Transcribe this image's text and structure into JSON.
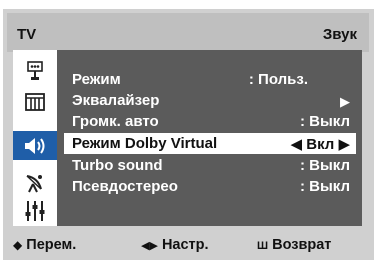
{
  "header": {
    "source": "TV",
    "title": "Звук"
  },
  "sidebar": {
    "icons": [
      "input-icon",
      "picture-icon",
      "sound-icon",
      "channel-icon",
      "setup-icon"
    ],
    "active_index": 2
  },
  "menu": {
    "items": [
      {
        "label": "Режим",
        "value": ": Польз."
      },
      {
        "label": "Эквалайзер",
        "value": "▶"
      },
      {
        "label": "Громк. авто",
        "value": ": Выкл"
      },
      {
        "label": "Режим Dolby Virtual",
        "value": "◀ Вкл ▶"
      },
      {
        "label": "Turbo sound",
        "value": ": Выкл"
      },
      {
        "label": "Псевдостерео",
        "value": ": Выкл"
      }
    ],
    "selected_index": 3
  },
  "footer": {
    "move": {
      "glyph": "◆",
      "label": "Перем."
    },
    "adjust": {
      "glyph": "◀▶",
      "label": "Настр."
    },
    "return": {
      "glyph": "Ш",
      "label": "Возврат"
    }
  },
  "colors": {
    "panel": "#d0d0d0",
    "content": "#5b5b5b",
    "highlight": "#1f5ea8",
    "selected_row": "#ffffff"
  }
}
